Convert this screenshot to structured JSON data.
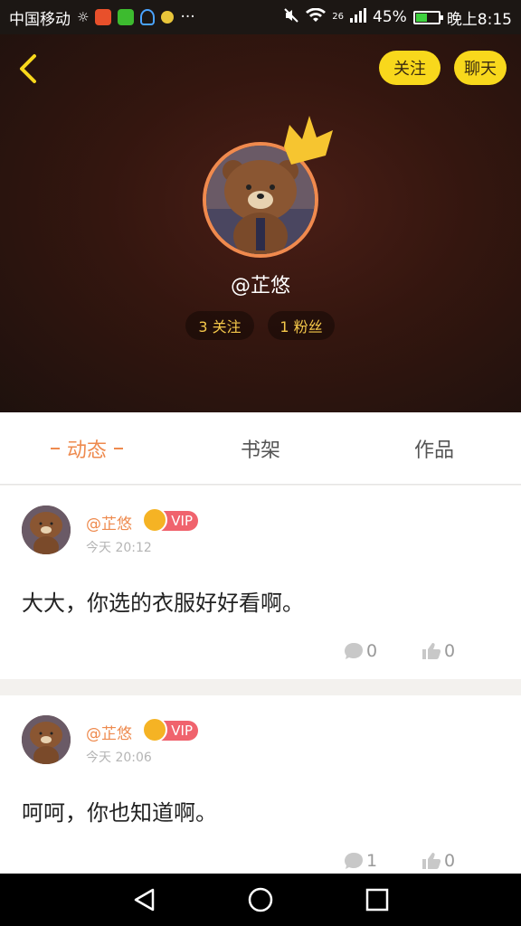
{
  "status_bar": {
    "carrier": "中国移动",
    "network": "26",
    "battery": "45%",
    "time": "晚上8:15",
    "battery_level": 0.45
  },
  "header": {
    "follow_button": "关注",
    "chat_button": "聊天",
    "username": "@芷悠",
    "following_stat": "3 关注",
    "fans_stat": "1 粉丝"
  },
  "tabs": [
    {
      "label": "动态",
      "active": true
    },
    {
      "label": "书架",
      "active": false
    },
    {
      "label": "作品",
      "active": false
    }
  ],
  "posts": [
    {
      "author": "@芷悠",
      "badge": "VIP",
      "time": "今天 20:12",
      "text": "大大，你选的衣服好好看啊。",
      "comments": "0",
      "likes": "0"
    },
    {
      "author": "@芷悠",
      "badge": "VIP",
      "time": "今天 20:06",
      "text": "呵呵，你也知道啊。",
      "comments": "1",
      "likes": "0"
    }
  ],
  "colors": {
    "accent": "#ee8a4e",
    "button_yellow": "#f8d81c",
    "vip_red": "#f0636d",
    "header_dark": "#34160f"
  },
  "icons": [
    "back-arrow-icon",
    "crown-icon",
    "comment-icon",
    "thumbs-up-icon",
    "nav-back-icon",
    "nav-home-icon",
    "nav-recent-icon"
  ]
}
